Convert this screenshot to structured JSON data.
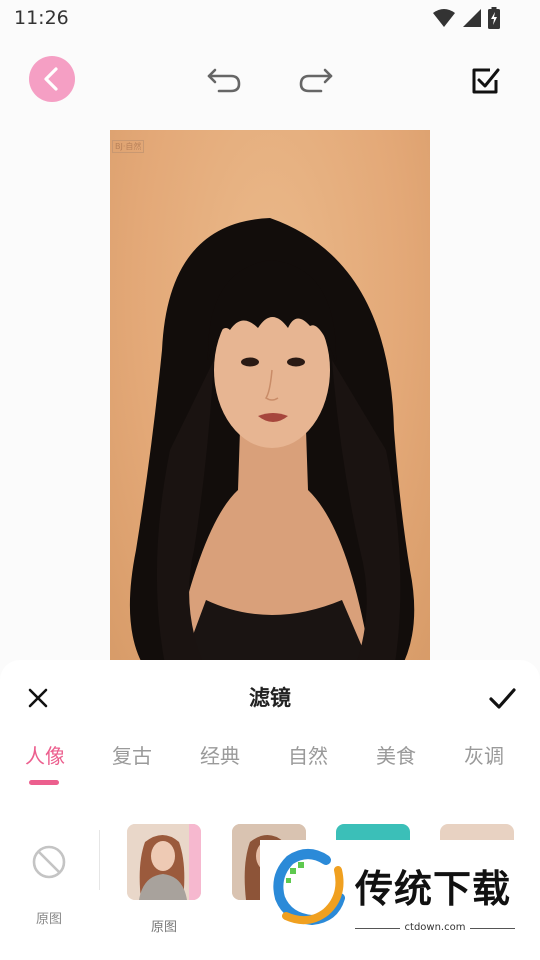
{
  "status_bar": {
    "time": "11:26"
  },
  "editor": {
    "photo_tag": "BJ·自然"
  },
  "sheet": {
    "title": "滤镜",
    "tabs": [
      {
        "label": "人像",
        "active": true
      },
      {
        "label": "复古",
        "active": false
      },
      {
        "label": "经典",
        "active": false
      },
      {
        "label": "自然",
        "active": false
      },
      {
        "label": "美食",
        "active": false
      },
      {
        "label": "灰调",
        "active": false
      }
    ],
    "none_label": "原图",
    "filters": [
      {
        "label": "原图"
      },
      {
        "label": "原"
      },
      {
        "label": ""
      },
      {
        "label": ""
      }
    ]
  },
  "watermark": {
    "text": "传统下载",
    "url": "ctdown.com"
  },
  "colors": {
    "accent": "#ec5f8e",
    "back_button": "#f59fc4"
  }
}
